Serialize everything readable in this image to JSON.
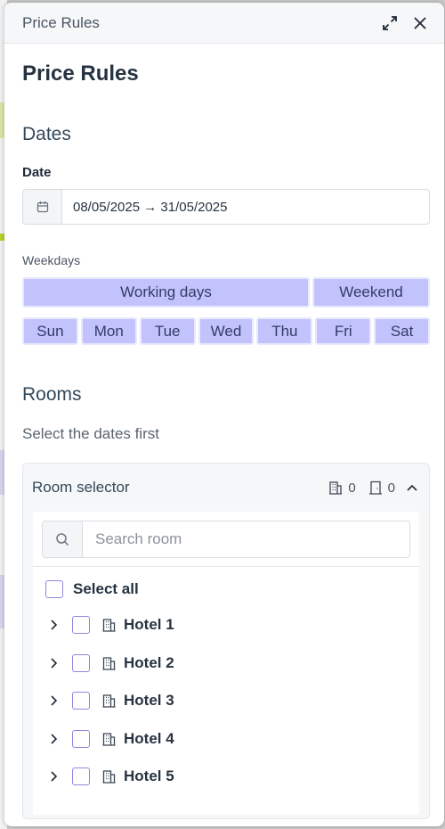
{
  "drawer": {
    "header_title": "Price Rules",
    "page_title": "Price Rules"
  },
  "dates": {
    "section_title": "Dates",
    "date_label": "Date",
    "date_value": "08/05/2025 → 31/05/2025",
    "weekdays_label": "Weekdays",
    "groups": [
      "Working days",
      "Weekend"
    ],
    "days": [
      "Sun",
      "Mon",
      "Tue",
      "Wed",
      "Thu",
      "Fri",
      "Sat"
    ]
  },
  "rooms": {
    "section_title": "Rooms",
    "hint": "Select the dates first",
    "selector": {
      "title": "Room selector",
      "hotel_count": "0",
      "room_count": "0",
      "search_placeholder": "Search room",
      "select_all_label": "Select all",
      "hotels": [
        "Hotel 1",
        "Hotel 2",
        "Hotel 3",
        "Hotel 4",
        "Hotel 5"
      ]
    }
  },
  "colors": {
    "weekday_button": "#c2c3fc",
    "checkbox_border": "#8c89e0"
  },
  "icons": [
    "expand-icon",
    "close-icon",
    "calendar-icon",
    "building-icon",
    "door-icon",
    "chevron-up-icon",
    "search-icon",
    "chevron-right-icon"
  ]
}
